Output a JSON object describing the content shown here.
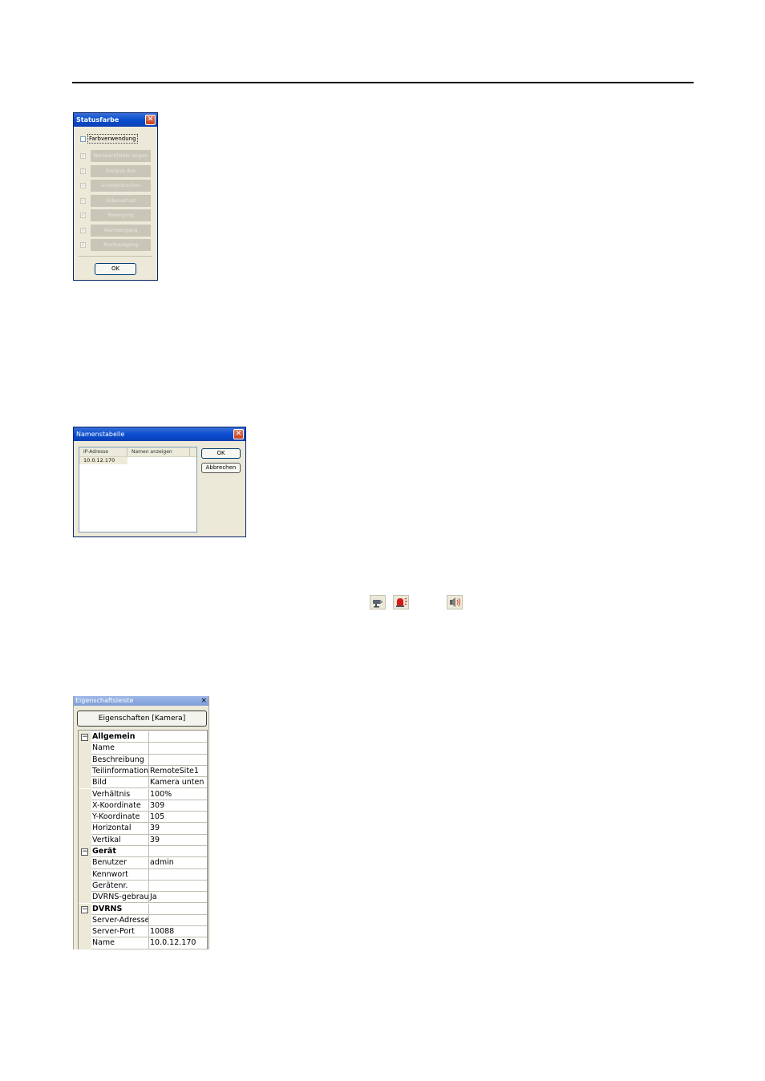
{
  "statusfarbe": {
    "title": "Statusfarbe",
    "close": "✕",
    "checkbox_label": "Farbverwendung",
    "items": [
      {
        "label": "Netzwerkfehler zeigen"
      },
      {
        "label": "Ereignis Aus"
      },
      {
        "label": "Ununterbrochen"
      },
      {
        "label": "Videoverlust"
      },
      {
        "label": "Bewegung"
      },
      {
        "label": "Alarmeingang"
      },
      {
        "label": "Alarmausgang"
      }
    ],
    "ok_label": "OK"
  },
  "namenstabelle": {
    "title": "Namenstabelle",
    "close": "✕",
    "columns": [
      "IP-Adresse",
      "Namen anzeigen"
    ],
    "rows": [
      [
        "10.0.12.170",
        ""
      ]
    ],
    "ok_label": "OK",
    "cancel_label": "Abbrechen"
  },
  "toolbar_icons": [
    "camera-icon",
    "alarm-siren-icon",
    "speaker-icon"
  ],
  "properties": {
    "title": "Eigenschaftsleiste",
    "close": "×",
    "header_button": "Eigenschaften [Kamera]",
    "rows": [
      {
        "type": "category",
        "key": "Allgemein",
        "value": ""
      },
      {
        "type": "prop",
        "key": "Name",
        "value": ""
      },
      {
        "type": "prop",
        "key": "Beschreibung",
        "value": ""
      },
      {
        "type": "prop",
        "key": "Teilinformation",
        "value": "RemoteSite1"
      },
      {
        "type": "prop",
        "key": "Bild",
        "value": "Kamera unten"
      },
      {
        "type": "prop",
        "key": "Verhältnis",
        "value": "100%"
      },
      {
        "type": "prop",
        "key": "X-Koordinate",
        "value": "309"
      },
      {
        "type": "prop",
        "key": "Y-Koordinate",
        "value": "105"
      },
      {
        "type": "prop",
        "key": "Horizontal",
        "value": "39"
      },
      {
        "type": "prop",
        "key": "Vertikal",
        "value": "39"
      },
      {
        "type": "category",
        "key": "Gerät",
        "value": ""
      },
      {
        "type": "prop",
        "key": "Benutzer",
        "value": "admin"
      },
      {
        "type": "prop",
        "key": "Kennwort",
        "value": ""
      },
      {
        "type": "prop",
        "key": "Gerätenr.",
        "value": ""
      },
      {
        "type": "prop",
        "key": "DVRNS-gebrauch",
        "value": "Ja"
      },
      {
        "type": "category",
        "key": "DVRNS",
        "value": ""
      },
      {
        "type": "prop",
        "key": "Server-Adresse",
        "value": ""
      },
      {
        "type": "prop",
        "key": "Server-Port",
        "value": "10088"
      },
      {
        "type": "prop",
        "key": "Name",
        "value": "10.0.12.170"
      }
    ]
  }
}
